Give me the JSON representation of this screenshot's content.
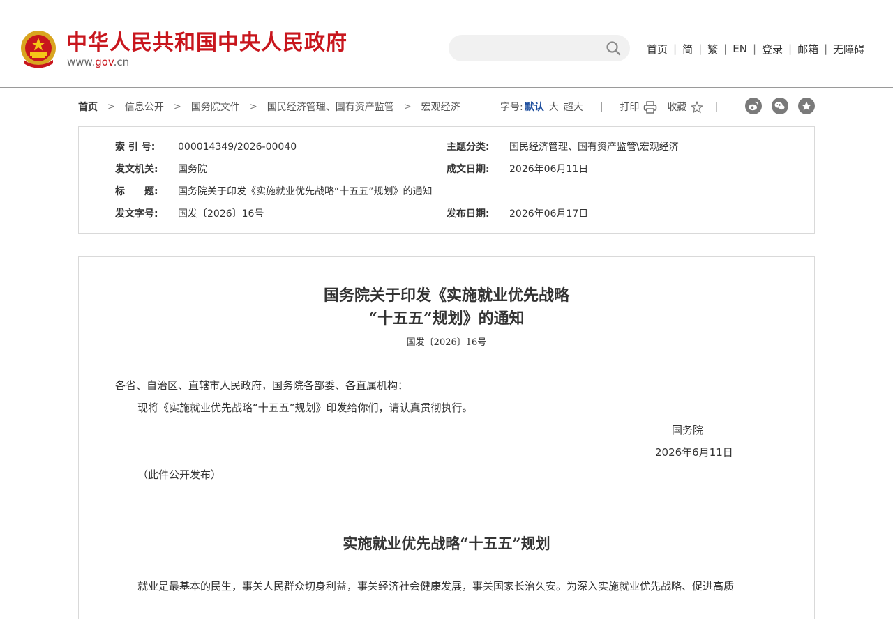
{
  "header": {
    "site_name": "中华人民共和国中央人民政府",
    "domain_prefix": "www.",
    "domain_main": "gov",
    "domain_suffix": ".cn",
    "search_placeholder": "",
    "nav": [
      "首页",
      "简",
      "繁",
      "EN",
      "登录",
      "邮箱",
      "无障碍"
    ],
    "nav_separator": "|"
  },
  "breadcrumb": {
    "items": [
      "首页",
      "信息公开",
      "国务院文件",
      "国民经济管理、国有资产监管",
      "宏观经济"
    ],
    "arrow": ">"
  },
  "tools": {
    "font_size_label": "字号:",
    "font_default": "默认",
    "font_large": "大",
    "font_xlarge": "超大",
    "print_label": "打印",
    "favorite_label": "收藏",
    "bar": "|"
  },
  "share": [
    "weibo-icon",
    "wechat-icon",
    "favorite-star-icon"
  ],
  "meta": {
    "index_label": "索 引 号:",
    "index_value": "000014349/2026-00040",
    "topic_label": "主题分类:",
    "topic_value": "国民经济管理、国有资产监管\\宏观经济",
    "issuer_label": "发文机关:",
    "issuer_value": "国务院",
    "written_label": "成文日期:",
    "written_value": "2026年06月11日",
    "title_label": "标　　题:",
    "title_value": "国务院关于印发《实施就业优先战略“十五五”规划》的通知",
    "docno_label": "发文字号:",
    "docno_value": "国发〔2026〕16号",
    "published_label": "发布日期:",
    "published_value": "2026年06月17日"
  },
  "article": {
    "title_line1": "国务院关于印发《实施就业优先战略",
    "title_line2": "“十五五”规划》的通知",
    "doc_number": "国发〔2026〕16号",
    "recipients": "各省、自治区、直辖市人民政府，国务院各部委、各直属机构：",
    "body": "现将《实施就业优先战略“十五五”规划》印发给你们，请认真贯彻执行。",
    "signer": "国务院",
    "sign_date": "2026年6月11日",
    "note": "（此件公开发布）",
    "plan_title": "实施就业优先战略“十五五”规划",
    "plan_first_line": "就业是最基本的民生，事关人民群众切身利益，事关经济社会健康发展，事关国家长治久安。为深入实施就业优先战略、促进高质"
  },
  "colors": {
    "brand_red": "#c8161d",
    "link_blue": "#1d4e9e",
    "border": "#d9d9d9"
  }
}
